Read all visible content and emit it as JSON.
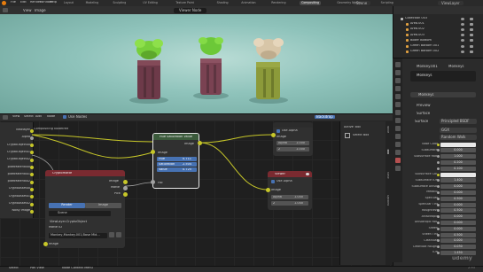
{
  "menu": {
    "items": [
      "File",
      "Edit",
      "Render",
      "Window",
      "Help"
    ],
    "workspaces": [
      "Layout",
      "Modeling",
      "Sculpting",
      "UV Editing",
      "Texture Paint",
      "Shading",
      "Animation",
      "Rendering",
      "Compositing",
      "Geometry Nodes",
      "Scripting"
    ],
    "active_workspace": "Compositing",
    "scene": "Scene",
    "view_layer": "ViewLayer"
  },
  "viewport": {
    "header": [
      "View",
      "Image"
    ],
    "image_name": "Viewer Node",
    "overlay_left": "Display Channels"
  },
  "node_editor": {
    "menu": [
      "View",
      "Select",
      "Add",
      "Node"
    ],
    "use_nodes": "Use Nodes",
    "toggle": "Backdrop",
    "backdrop_channel": "Pass Index"
  },
  "outliner": {
    "rows": [
      "Collection 003",
      "Area.001",
      "Area.002",
      "Area.003",
      "Boxer Bottom",
      "Green Bottom 001",
      "Green Bottom 002"
    ]
  },
  "left_list": {
    "items": [
      "Viewlayer",
      "Alpha",
      "CryptoObject00",
      "CryptoObject01",
      "CryptoObject02",
      "pixelMaterial00",
      "pixelMaterial01",
      "pixelMaterial02",
      "CryptoAsset00",
      "CryptoAsset01",
      "CryptoAsset02",
      "Noisy Image"
    ],
    "header": "Compositing Nodetree"
  },
  "nodes": {
    "hsv": {
      "title": "Hue Saturation Value",
      "out": "Image",
      "in_image": "Image",
      "hue_label": "Hue",
      "hue": "0.711",
      "sat_label": "Saturation",
      "sat": "2.504",
      "val_label": "Value",
      "val": "0.725",
      "fac": "Fac"
    },
    "composite": {
      "title": "Composite",
      "use_alpha": "Use Alpha",
      "image": "Image",
      "alpha_label": "Alpha",
      "alpha": "1.000",
      "z_label": "Z",
      "z": "1.000"
    },
    "viewer": {
      "title": "Viewer",
      "use_alpha": "Use Alpha",
      "image": "Image",
      "alpha_label": "Alpha",
      "alpha": "1.000",
      "z_label": "Z",
      "z": "1.000"
    },
    "crypto": {
      "title": "Cryptomatte",
      "out_image": "Image",
      "out_matte": "Matte",
      "out_pick": "Pick",
      "tab_render": "Render",
      "tab_image": "Image",
      "scene": "Scene",
      "layer": "ViewLayer.CryptoObject",
      "matte_id_label": "Matte ID",
      "matte_id": "Monkey,Monkey.001,Base Mid...",
      "in_image": "Image"
    }
  },
  "sidepanel": {
    "title": "Active Tool",
    "item": "Select Box",
    "tabs": [
      "Node",
      "Tool",
      "View",
      "Options"
    ]
  },
  "properties": {
    "object": "Monkey.001",
    "material_tab": "Monkeys",
    "material_slot": "Monkeys",
    "preview": "Preview",
    "surface": "Surface",
    "surface_shader": "Principled BSDF",
    "distribution": "GGX",
    "subsurface_method": "Random Walk",
    "rows": [
      {
        "label": "Base Color",
        "value": ""
      },
      {
        "label": "Subsurface",
        "value": "0.000"
      },
      {
        "label": "Subsurface Rad.",
        "value": "1.000"
      },
      {
        "label": "",
        "value": "0.200"
      },
      {
        "label": "",
        "value": "0.100"
      },
      {
        "label": "Subsurface Col.",
        "value": ""
      },
      {
        "label": "Subsurface IOR",
        "value": "1.400"
      },
      {
        "label": "Subsurface Aniso.",
        "value": "0.000"
      },
      {
        "label": "Metallic",
        "value": "0.000"
      },
      {
        "label": "Specular",
        "value": "0.500"
      },
      {
        "label": "Specular Tint",
        "value": "0.000"
      },
      {
        "label": "Roughness",
        "value": "0.500"
      },
      {
        "label": "Anisotropic",
        "value": "0.000"
      },
      {
        "label": "Anisotropic Rot.",
        "value": "0.000"
      },
      {
        "label": "Sheen",
        "value": "0.000"
      },
      {
        "label": "Sheen Tint",
        "value": "0.500"
      },
      {
        "label": "Clearcoat",
        "value": "0.000"
      },
      {
        "label": "Clearcoat Rough.",
        "value": "0.030"
      },
      {
        "label": "IOR",
        "value": "1.450"
      }
    ]
  },
  "statusbar": {
    "left": "Select",
    "mid": "Pan View",
    "right": "Node Context Menu",
    "version": "2.93"
  },
  "watermark": "udemy",
  "colors": {
    "accent": "#4772b3",
    "node_header_hsv": "#3b5a3b",
    "node_header_comp": "#2c2c2c",
    "node_header_viewer": "#7a2a30",
    "socket_yellow": "#c7c729",
    "socket_gray": "#a1a1a1",
    "socket_blue": "#6363c7",
    "backdrop": "#8fc3bb"
  }
}
